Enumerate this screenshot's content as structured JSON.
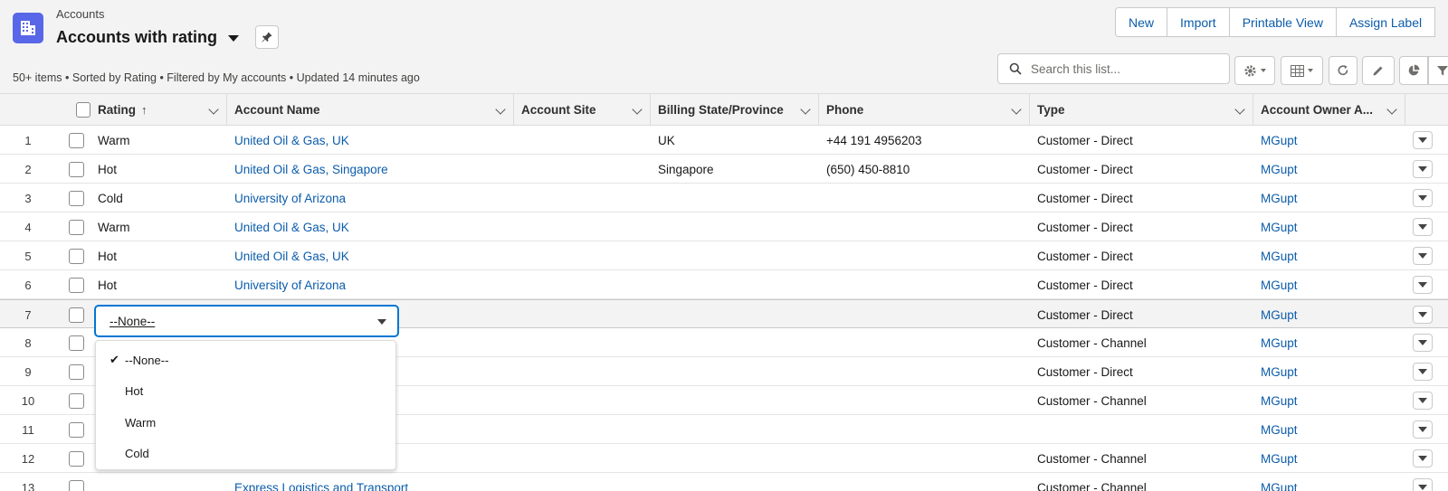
{
  "header": {
    "breadcrumb": "Accounts",
    "title": "Accounts with rating",
    "actions": [
      "New",
      "Import",
      "Printable View",
      "Assign Label"
    ],
    "meta": "50+ items • Sorted by Rating • Filtered by My accounts • Updated 14 minutes ago",
    "search_placeholder": "Search this list...",
    "accent_color": "#5867e8",
    "link_color": "#0b5cab"
  },
  "columns": [
    "Rating",
    "Account Name",
    "Account Site",
    "Billing State/Province",
    "Phone",
    "Type",
    "Account Owner A..."
  ],
  "sort_indicator": "↑",
  "rows": [
    {
      "n": "1",
      "rating": "Warm",
      "name": "United Oil & Gas, UK",
      "site": "",
      "state": "UK",
      "phone": "+44 191 4956203",
      "type": "Customer - Direct",
      "owner": "MGupt"
    },
    {
      "n": "2",
      "rating": "Hot",
      "name": "United Oil & Gas, Singapore",
      "site": "",
      "state": "Singapore",
      "phone": "(650) 450-8810",
      "type": "Customer - Direct",
      "owner": "MGupt"
    },
    {
      "n": "3",
      "rating": "Cold",
      "name": "University of Arizona",
      "site": "",
      "state": "",
      "phone": "",
      "type": "Customer - Direct",
      "owner": "MGupt"
    },
    {
      "n": "4",
      "rating": "Warm",
      "name": "United Oil & Gas, UK",
      "site": "",
      "state": "",
      "phone": "",
      "type": "Customer - Direct",
      "owner": "MGupt"
    },
    {
      "n": "5",
      "rating": "Hot",
      "name": "United Oil & Gas, UK",
      "site": "",
      "state": "",
      "phone": "",
      "type": "Customer - Direct",
      "owner": "MGupt"
    },
    {
      "n": "6",
      "rating": "Hot",
      "name": "University of Arizona",
      "site": "",
      "state": "",
      "phone": "",
      "type": "Customer - Direct",
      "owner": "MGupt"
    },
    {
      "n": "7",
      "rating": "",
      "name": "",
      "site": "",
      "state": "",
      "phone": "",
      "type": "Customer - Direct",
      "owner": "MGupt"
    },
    {
      "n": "8",
      "rating": "",
      "name": "",
      "site": "",
      "state": "",
      "phone": "",
      "type": "Customer - Channel",
      "owner": "MGupt"
    },
    {
      "n": "9",
      "rating": "",
      "name": "",
      "site": "",
      "state": "",
      "phone": "",
      "type": "Customer - Direct",
      "owner": "MGupt"
    },
    {
      "n": "10",
      "rating": "",
      "name": "",
      "site": "",
      "state": "",
      "phone": "",
      "type": "Customer - Channel",
      "owner": "MGupt"
    },
    {
      "n": "11",
      "rating": "",
      "name": "",
      "site": "",
      "state": "",
      "phone": "",
      "type": "",
      "owner": "MGupt"
    },
    {
      "n": "12",
      "rating": "",
      "name": "",
      "site": "",
      "state": "",
      "phone": "",
      "type": "Customer - Channel",
      "owner": "MGupt"
    },
    {
      "n": "13",
      "rating": "",
      "name": "Express Logistics and Transport",
      "site": "",
      "state": "",
      "phone": "",
      "type": "Customer - Channel",
      "owner": "MGupt"
    }
  ],
  "editor": {
    "value": "--None--",
    "options": [
      "--None--",
      "Hot",
      "Warm",
      "Cold"
    ],
    "selected": "--None--"
  }
}
